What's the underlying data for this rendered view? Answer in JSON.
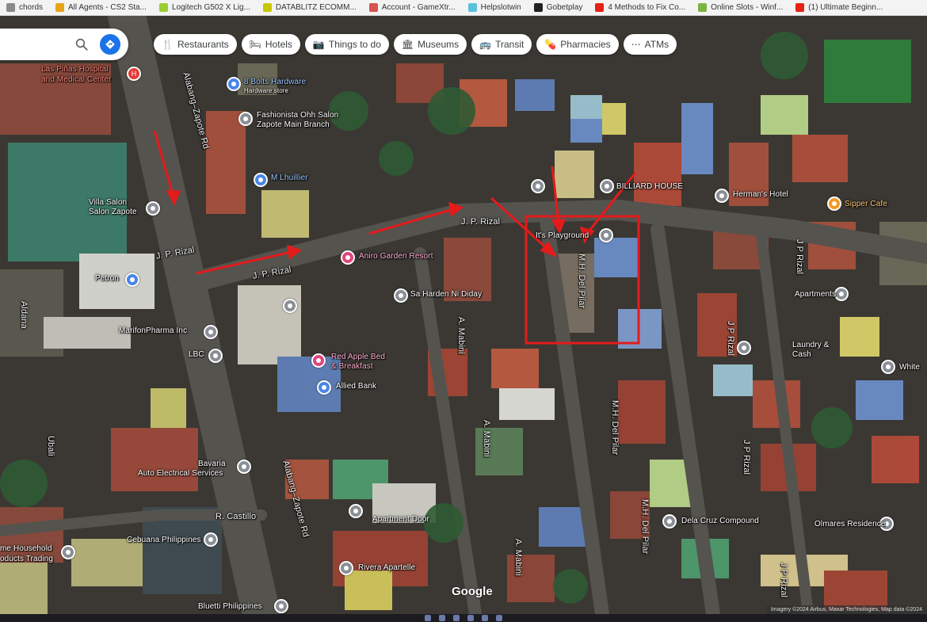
{
  "bookmarks": [
    {
      "label": "chords",
      "color": "#8a8a8a"
    },
    {
      "label": "All Agents - CS2 Sta...",
      "color": "#e8a317"
    },
    {
      "label": "Logitech G502 X Lig...",
      "color": "#9acd32"
    },
    {
      "label": "DATABLITZ ECOMM...",
      "color": "#c8c800"
    },
    {
      "label": "Account - GameXtr...",
      "color": "#d9534f"
    },
    {
      "label": "Helpslotwin",
      "color": "#5bc0de"
    },
    {
      "label": "Gobetplay",
      "color": "#222222"
    },
    {
      "label": "4 Methods to Fix Co...",
      "color": "#e62117"
    },
    {
      "label": "Online Slots - Winf...",
      "color": "#7cb342"
    },
    {
      "label": "(1) Ultimate Beginn...",
      "color": "#e62117"
    }
  ],
  "chips": [
    {
      "label": "Restaurants",
      "icon": "fork-knife-icon",
      "glyph": "🍴"
    },
    {
      "label": "Hotels",
      "icon": "bed-icon",
      "glyph": "🛏"
    },
    {
      "label": "Things to do",
      "icon": "camera-icon",
      "glyph": "📷"
    },
    {
      "label": "Museums",
      "icon": "museum-icon",
      "glyph": "🏛"
    },
    {
      "label": "Transit",
      "icon": "bus-icon",
      "glyph": "🚌"
    },
    {
      "label": "Pharmacies",
      "icon": "pill-icon",
      "glyph": "💊"
    },
    {
      "label": "ATMs",
      "icon": "atm-icon",
      "glyph": "⋯"
    }
  ],
  "labels": {
    "las_pinas_hospital": "Las Piñas Hospital",
    "and_medical_center": "and Medical Center",
    "eight_bolts": "8 Bolts Hardware",
    "hardware_store": "Hardware store",
    "fashionista": "Fashionista Ohh Salon",
    "zapote_main": "Zapote Main Branch",
    "m_lhuillier": "M Lhuillier",
    "villa_salon": "Villa Salon",
    "salon_zapote": "Salon Zapote",
    "alabang_zapote_rd_top": "Alabang–Zapote Rd",
    "alabang_zapote_rd_bottom": "Alabang–Zapote Rd",
    "jp_rizal_1": "J. P. Rizal",
    "jp_rizal_2": "J. P. Rizal",
    "jp_rizal_3": "J. P. Rizal",
    "jp_rizal_4": "J P Rizal",
    "jp_rizal_5": "J P Rizal",
    "jp_rizal_6": "J P Rizal",
    "jp_rizal_7": "J P Rizal",
    "petron": "Petron",
    "aniro_garden": "Aniro Garden Resort",
    "sa_harden": "Sa Harden Ni Diday",
    "marifon": "MarifonPharma Inc",
    "lbc": "LBC",
    "red_apple": "Red Apple Bed",
    "breakfast": "& Breakfast",
    "allied_bank": "Allied Bank",
    "a_mabini_1": "A. Mabini",
    "a_mabini_2": "A. Mabini",
    "a_mabini_3": "A. Mabini",
    "mh_del_pilar_1": "M.H. Del Pilar",
    "mh_del_pilar_2": "M.H. Del Pilar",
    "mh_del_pilar_3": "M.H. Del Pilar",
    "its_playground": "It's Playground",
    "billiard_house": "BILLIARD HOUSE",
    "hermans_hotel": "Herman's Hotel",
    "sipper_cafe": "Sipper Cafe",
    "apartments": "Apartments",
    "laundry": "Laundry &",
    "cash": "Cash",
    "white": "White",
    "alcala": "Aldana",
    "auto_electrical": "Auto Electrical Services",
    "bavaria": "Bavaria",
    "r_castillo": "R. Castillo",
    "cebuana": "Cebuana Philippines",
    "household": "me Household",
    "products_trading": "oducts Trading",
    "rivera": "Rivera Apartelle",
    "bluetti": "Bluetti Philippines",
    "dela_cruz": "Dela Cruz Compound",
    "olmares": "Olmares Residence",
    "ubali": "Ubali",
    "apartment_door": "Apartment Door",
    "google": "Google",
    "attribution": "Imagery ©2024 Airbus, Maxar Technologies, Map data ©2024"
  },
  "colors": {
    "annotation_red": "#e41b1b",
    "search_blue": "#1a73e8"
  }
}
